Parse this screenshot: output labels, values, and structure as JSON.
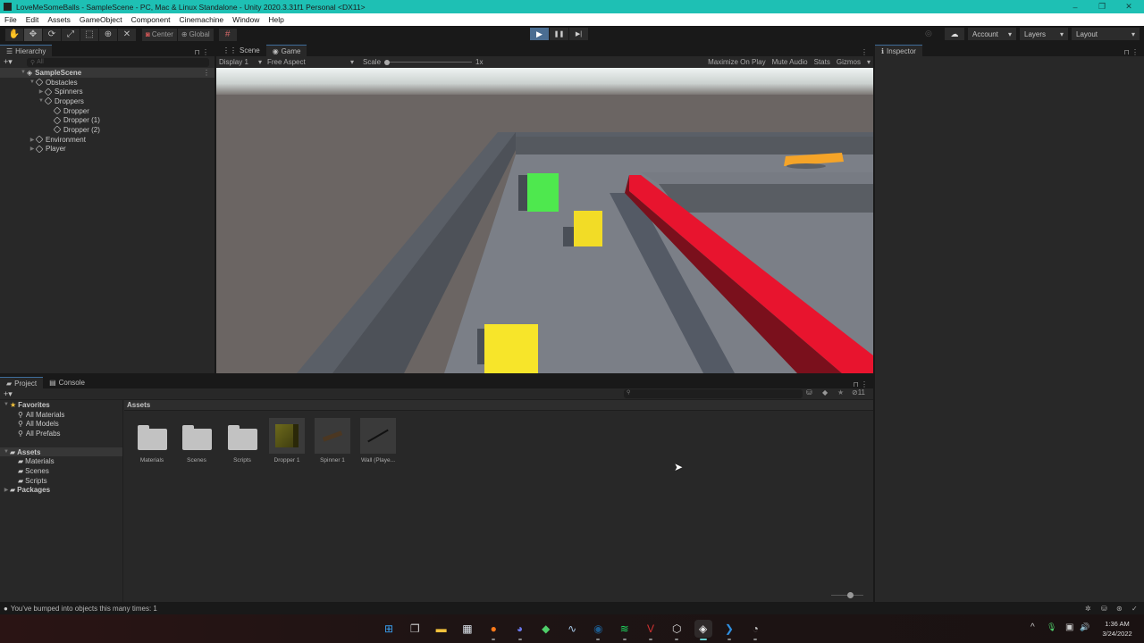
{
  "window": {
    "title": "LoveMeSomeBalls - SampleScene - PC, Mac & Linux Standalone - Unity 2020.3.31f1 Personal <DX11>",
    "controls": {
      "minimize": "–",
      "maximize": "❐",
      "close": "✕"
    }
  },
  "menu": [
    "File",
    "Edit",
    "Assets",
    "GameObject",
    "Component",
    "Cinemachine",
    "Window",
    "Help"
  ],
  "toolbar": {
    "tools": [
      {
        "name": "hand-tool",
        "glyph": "✋"
      },
      {
        "name": "move-tool",
        "glyph": "✥"
      },
      {
        "name": "rotate-tool",
        "glyph": "⟳"
      },
      {
        "name": "scale-tool",
        "glyph": "⤢"
      },
      {
        "name": "rect-tool",
        "glyph": "⬚"
      },
      {
        "name": "transform-tool",
        "glyph": "⊕"
      },
      {
        "name": "custom-tool",
        "glyph": "✕"
      }
    ],
    "pivot_label": "Center",
    "space_label": "Global",
    "snap_glyph": "#",
    "play_glyph": "▶",
    "pause_glyph": "❚❚",
    "step_glyph": "▶|",
    "play_active": true,
    "collab_glyph": "◎",
    "cloud_glyph": "☁",
    "account_label": "Account",
    "layers_label": "Layers",
    "layout_label": "Layout"
  },
  "hierarchy": {
    "tab_label": "Hierarchy",
    "add_glyph": "+▾",
    "search_placeholder": "All",
    "scene_name": "SampleScene",
    "items": [
      {
        "label": "Obstacles",
        "depth": 1,
        "arrow": "▼"
      },
      {
        "label": "Spinners",
        "depth": 2,
        "arrow": "▶"
      },
      {
        "label": "Droppers",
        "depth": 2,
        "arrow": "▼"
      },
      {
        "label": "Dropper",
        "depth": 3,
        "arrow": ""
      },
      {
        "label": "Dropper (1)",
        "depth": 3,
        "arrow": ""
      },
      {
        "label": "Dropper (2)",
        "depth": 3,
        "arrow": ""
      },
      {
        "label": "Environment",
        "depth": 1,
        "arrow": "▶"
      },
      {
        "label": "Player",
        "depth": 1,
        "arrow": "▶"
      }
    ]
  },
  "game_view": {
    "tabs": [
      {
        "label": "Scene",
        "glyph": "⋮⋮"
      },
      {
        "label": "Game",
        "glyph": "◉"
      }
    ],
    "active_tab": "Game",
    "display_label": "Display 1",
    "aspect_label": "Free Aspect",
    "scale_label": "Scale",
    "scale_value": "1x",
    "scale_slider_fraction": 0,
    "toggles": [
      "Maximize On Play",
      "Mute Audio",
      "Stats",
      "Gizmos"
    ]
  },
  "inspector": {
    "tab_label": "Inspector",
    "glyph": "ℹ"
  },
  "project": {
    "tabs": [
      {
        "label": "Project",
        "glyph": "▰"
      },
      {
        "label": "Console",
        "glyph": "▤"
      }
    ],
    "add_glyph": "+▾",
    "search_placeholder": "",
    "hidden_count": "11",
    "favorites_label": "Favorites",
    "favorites": [
      "All Materials",
      "All Models",
      "All Prefabs"
    ],
    "assets_root": "Assets",
    "asset_folders": [
      "Materials",
      "Scenes",
      "Scripts"
    ],
    "packages_label": "Packages",
    "breadcrumb": "Assets",
    "items": [
      {
        "label": "Materials",
        "kind": "folder"
      },
      {
        "label": "Scenes",
        "kind": "folder"
      },
      {
        "label": "Scripts",
        "kind": "folder"
      },
      {
        "label": "Dropper 1",
        "kind": "prefab-cube"
      },
      {
        "label": "Spinner 1",
        "kind": "prefab-spinner"
      },
      {
        "label": "Wall (Playe...",
        "kind": "prefab-wall"
      }
    ],
    "zoom_slider_fraction": 0.6
  },
  "status": {
    "message": "You've bumped into objects this many times: 1"
  },
  "taskbar": {
    "apps": [
      {
        "name": "start",
        "glyph": "⊞",
        "color": "#3aa0f0"
      },
      {
        "name": "task-view",
        "glyph": "❐",
        "color": "#cfcfcf"
      },
      {
        "name": "file-explorer",
        "glyph": "▬",
        "color": "#f2c23c"
      },
      {
        "name": "microsoft-store",
        "glyph": "▦",
        "color": "#dfe6ee"
      },
      {
        "name": "firefox",
        "glyph": "●",
        "color": "#ff7a1a"
      },
      {
        "name": "discord",
        "glyph": "◕",
        "color": "#6b79ee"
      },
      {
        "name": "app-green",
        "glyph": "◆",
        "color": "#4fcf6a"
      },
      {
        "name": "monitor-app",
        "glyph": "∿",
        "color": "#a6c8e6"
      },
      {
        "name": "steam",
        "glyph": "◉",
        "color": "#1d5a8c"
      },
      {
        "name": "spotify",
        "glyph": "≋",
        "color": "#1ed760"
      },
      {
        "name": "voicemeeter",
        "glyph": "V",
        "color": "#d23232"
      },
      {
        "name": "unity-hub",
        "glyph": "⬡",
        "color": "#dddddd"
      },
      {
        "name": "unity-editor",
        "glyph": "◈",
        "color": "#eeeeee"
      },
      {
        "name": "vscode",
        "glyph": "❯",
        "color": "#2f8fe0"
      },
      {
        "name": "obs",
        "glyph": "◔",
        "color": "#cfcfcf"
      }
    ],
    "tray": {
      "chevron": "^",
      "mic": "🎙",
      "network": "▣",
      "volume": "🔊"
    },
    "time": "1:36 AM",
    "date": "3/24/2022"
  },
  "scene_colors": {
    "sky_top": "#e8eeee",
    "ground": "#6b6563",
    "floor": "#7c8088",
    "wall": "#565b63",
    "red_wall": "#e8142e",
    "green_cube": "#4ee84e",
    "yellow_cube": "#f2dc26",
    "orange_spinner": "#f5a428"
  }
}
